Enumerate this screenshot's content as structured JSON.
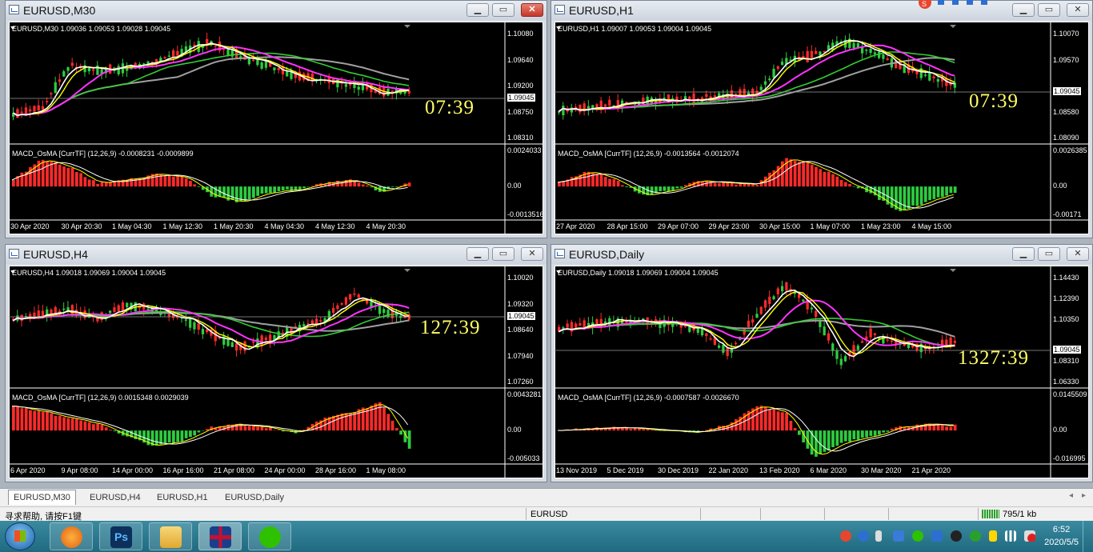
{
  "windows": [
    {
      "title": "EURUSD,M30",
      "ohlc": "EURUSD,M30  1.09036 1.09053 1.09028 1.09045",
      "macd_label": "MACD_OsMA [CurrTF] (12,26,9) -0.0008231 -0.0009899",
      "timer": "07:39",
      "price_ticks": [
        "1.10080",
        "1.09640",
        "1.09200",
        "1.08750",
        "1.08310"
      ],
      "current_price": "1.09045",
      "macd_ticks": [
        "0.0024033",
        "0.00",
        "-0.0013516"
      ],
      "time_ticks": [
        "30 Apr 2020",
        "30 Apr 20:30",
        "1 May 04:30",
        "1 May 12:30",
        "1 May 20:30",
        "4 May 04:30",
        "4 May 12:30",
        "4 May 20:30"
      ]
    },
    {
      "title": "EURUSD,H1",
      "ohlc": "EURUSD,H1  1.09007 1.09053 1.09004 1.09045",
      "macd_label": "MACD_OsMA [CurrTF] (12,26,9) -0.0013564 -0.0012074",
      "timer": "07:39",
      "price_ticks": [
        "1.10070",
        "1.09570",
        "1.09045",
        "1.08580",
        "1.08090"
      ],
      "current_price": "1.09045",
      "macd_ticks": [
        "0.0026385",
        "0.00",
        "-0.00171"
      ],
      "time_ticks": [
        "27 Apr 2020",
        "28 Apr 15:00",
        "29 Apr 07:00",
        "29 Apr 23:00",
        "30 Apr 15:00",
        "1 May 07:00",
        "1 May 23:00",
        "4 May 15:00"
      ]
    },
    {
      "title": "EURUSD,H4",
      "ohlc": "EURUSD,H4  1.09018 1.09069 1.09004 1.09045",
      "macd_label": "MACD_OsMA [CurrTF] (12,26,9) 0.0015348 0.0029039",
      "timer": "127:39",
      "price_ticks": [
        "1.10020",
        "1.09320",
        "1.08640",
        "1.07940",
        "1.07260"
      ],
      "current_price": "1.09045",
      "macd_ticks": [
        "0.0043281",
        "0.00",
        "-0.005033"
      ],
      "time_ticks": [
        "6 Apr 2020",
        "9 Apr 08:00",
        "14 Apr 00:00",
        "16 Apr 16:00",
        "21 Apr 08:00",
        "24 Apr 00:00",
        "28 Apr 16:00",
        "1 May 08:00"
      ]
    },
    {
      "title": "EURUSD,Daily",
      "ohlc": "EURUSD,Daily  1.09018 1.09069 1.09004 1.09045",
      "macd_label": "MACD_OsMA [CurrTF] (12,26,9) -0.0007587 -0.0026670",
      "timer": "1327:39",
      "price_ticks": [
        "1.14430",
        "1.12390",
        "1.10350",
        "1.09045",
        "1.08310",
        "1.06330"
      ],
      "current_price": "1.09045",
      "macd_ticks": [
        "0.0145509",
        "0.00",
        "-0.016995"
      ],
      "time_ticks": [
        "13 Nov 2019",
        "5 Dec 2019",
        "30 Dec 2019",
        "22 Jan 2020",
        "13 Feb 2020",
        "6 Mar 2020",
        "30 Mar 2020",
        "21 Apr 2020"
      ]
    }
  ],
  "tabs": [
    "EURUSD,M30",
    "EURUSD,H4",
    "EURUSD,H1",
    "EURUSD,Daily"
  ],
  "active_tab": "EURUSD,M30",
  "status": {
    "help": "寻求帮助, 请按F1键",
    "symbol": "EURUSD",
    "traffic": "795/1 kb"
  },
  "clock": {
    "time": "6:52",
    "date": "2020/5/5"
  },
  "colors": {
    "bull": "#2ecc40",
    "bear": "#ff2a2a",
    "ma_white": "#ffffff",
    "ma_yellow": "#ffff00",
    "ma_magenta": "#ff33ff",
    "ma_green": "#33cc33",
    "ma_gray": "#a0a0a0",
    "timer": "#ffff66"
  }
}
